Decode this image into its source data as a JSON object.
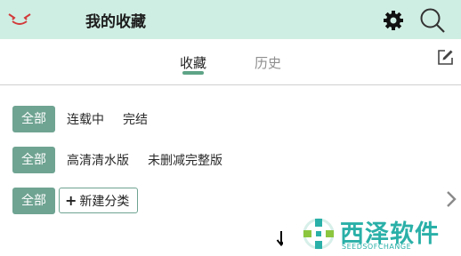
{
  "header": {
    "title": "我的收藏",
    "icons": [
      "app-logo-icon",
      "gear-icon",
      "search-icon"
    ],
    "background": "#cfeee3"
  },
  "tabs": [
    {
      "label": "收藏",
      "active": true
    },
    {
      "label": "历史",
      "active": false
    }
  ],
  "filters": {
    "status_row": {
      "all_label": "全部",
      "options": [
        "连载中",
        "完结"
      ]
    },
    "quality_row": {
      "all_label": "全部",
      "options": [
        "高清清水版",
        "未删减完整版"
      ]
    },
    "category_row": {
      "all_label": "全部",
      "new_category_label": "新建分类"
    }
  },
  "watermark": {
    "text": "西泽软件",
    "subtext": "SEEDSOFCHANGE"
  },
  "colors": {
    "accent": "#6fa392",
    "tab_underline": "#5ea487",
    "watermark": "#2ab0a8"
  }
}
